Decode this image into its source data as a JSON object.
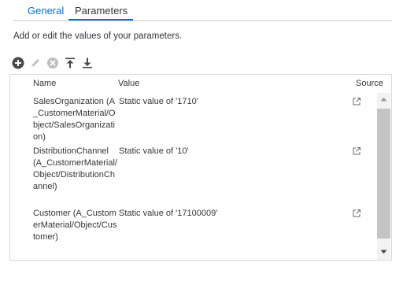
{
  "tabs": [
    {
      "label": "General",
      "active": false
    },
    {
      "label": "Parameters",
      "active": true
    }
  ],
  "description": "Add or edit the values of your parameters.",
  "toolbar": {
    "icons": [
      "add-icon",
      "edit-icon",
      "delete-icon",
      "move-to-top-icon",
      "move-to-bottom-icon"
    ]
  },
  "table": {
    "headers": {
      "name": "Name",
      "value": "Value",
      "source": "Source"
    },
    "rows": [
      {
        "name": "SalesOrganization (A_CustomerMaterial/Object/SalesOrganization)",
        "value": "Static value of '1710'"
      },
      {
        "name": "DistributionChannel (A_CustomerMaterial/Object/DistributionChannel)",
        "value": "Static value of '10'"
      },
      {
        "name": "Customer (A_CustomerMaterial/Object/Customer)",
        "value": "Static value of '17100009'"
      }
    ]
  },
  "colors": {
    "accent": "#0a6ed1",
    "text": "#32363a",
    "icon": "#5a5a5a",
    "icon_disabled": "#bfbfbf",
    "border": "#d9d9d9"
  }
}
